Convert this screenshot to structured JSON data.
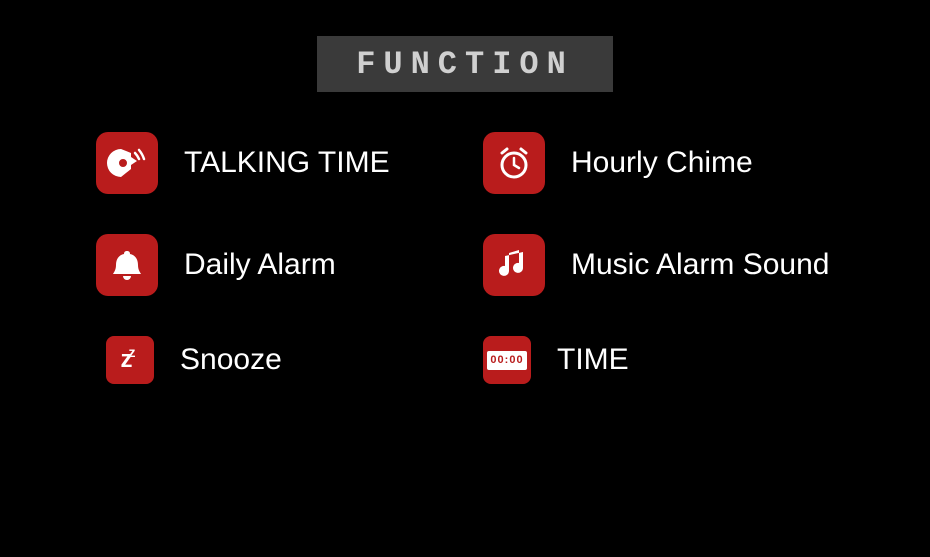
{
  "header": {
    "title": "FUNCTION"
  },
  "features": {
    "talking_time": {
      "label": "TALKING TIME"
    },
    "hourly_chime": {
      "label": "Hourly Chime"
    },
    "daily_alarm": {
      "label": "Daily Alarm"
    },
    "music_alarm": {
      "label": "Music Alarm Sound"
    },
    "snooze": {
      "label": "Snooze",
      "icon_text_main": "z",
      "icon_text_sup": "z"
    },
    "time": {
      "label": "TIME",
      "icon_digits": "00:00"
    }
  },
  "colors": {
    "accent": "#b91c1c",
    "bg": "#000000",
    "header_bg": "#3a3a3a"
  }
}
